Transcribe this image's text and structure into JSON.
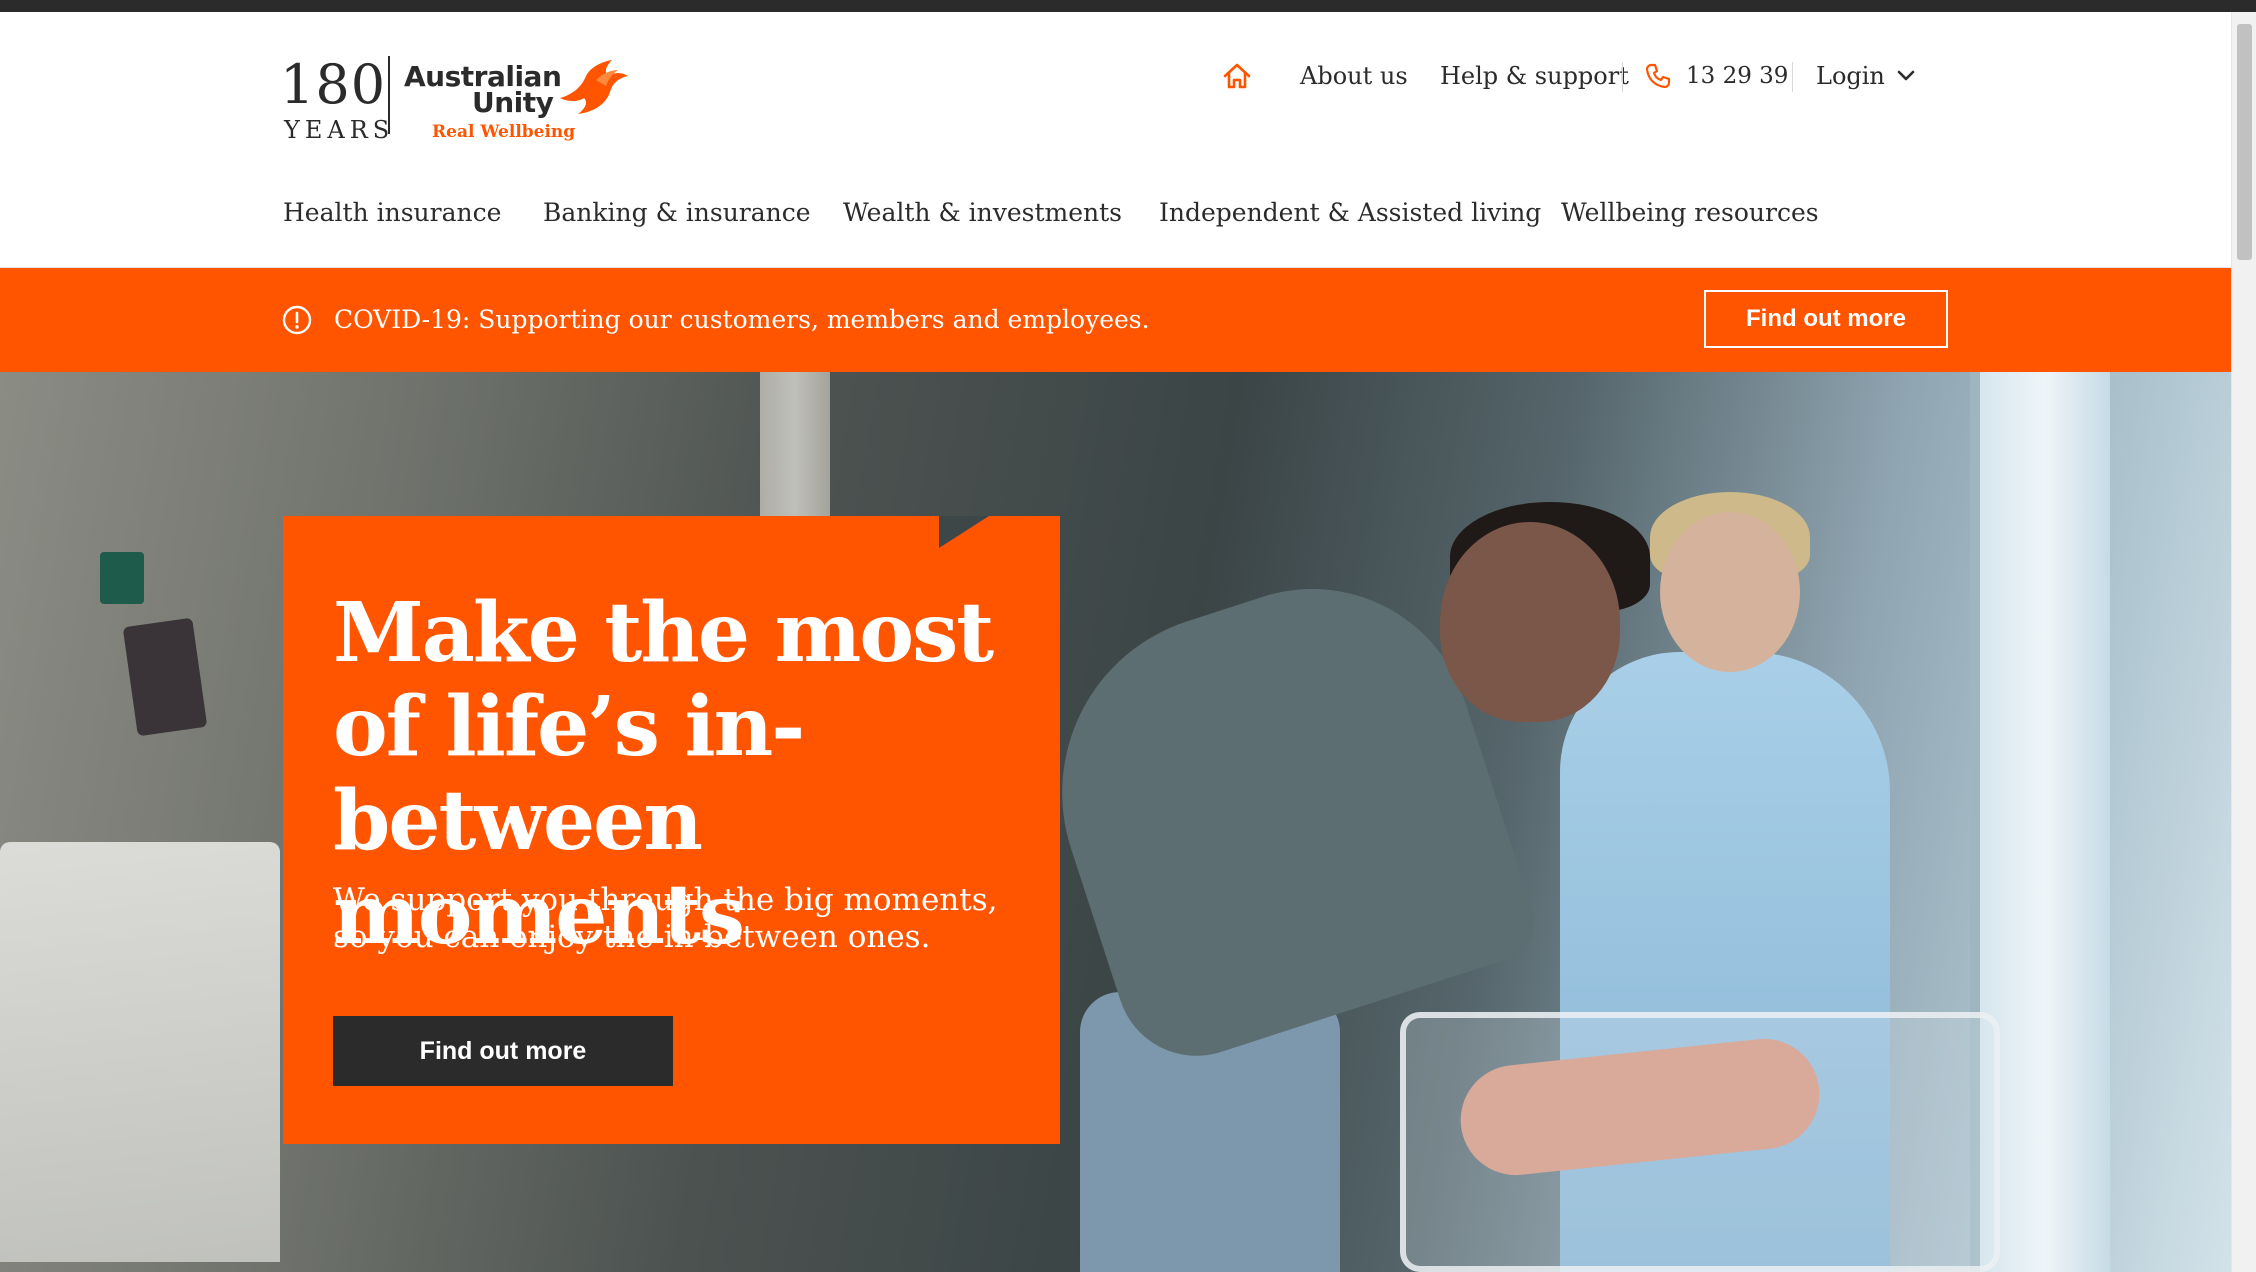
{
  "colors": {
    "brand": "#ff5500",
    "dark": "#2b2b2b",
    "white": "#ffffff"
  },
  "logo": {
    "years_number": "180",
    "years_word": "YEARS",
    "brand_line1": "Australian",
    "brand_line2": "Unity",
    "tagline": "Real Wellbeing",
    "icon": "bird-icon"
  },
  "utility_nav": {
    "home_icon": "home-icon",
    "about": "About us",
    "help": "Help & support",
    "phone_icon": "phone-icon",
    "phone": "13 29 39",
    "login": "Login",
    "login_icon": "chevron-down-icon"
  },
  "main_nav": [
    {
      "label": "Health insurance"
    },
    {
      "label": "Banking & insurance"
    },
    {
      "label": "Wealth & investments"
    },
    {
      "label": "Independent & Assisted living"
    },
    {
      "label": "Wellbeing resources"
    }
  ],
  "banner": {
    "icon": "alert-circle-icon",
    "message": "COVID-19: Supporting our customers, members and employees.",
    "button": "Find out more"
  },
  "hero": {
    "headline": "Make the most of life’s in-between moments",
    "subtext": "We support you through the big moments, so you can enjoy the in-between ones.",
    "button": "Find out more",
    "image": "hero-photo"
  }
}
